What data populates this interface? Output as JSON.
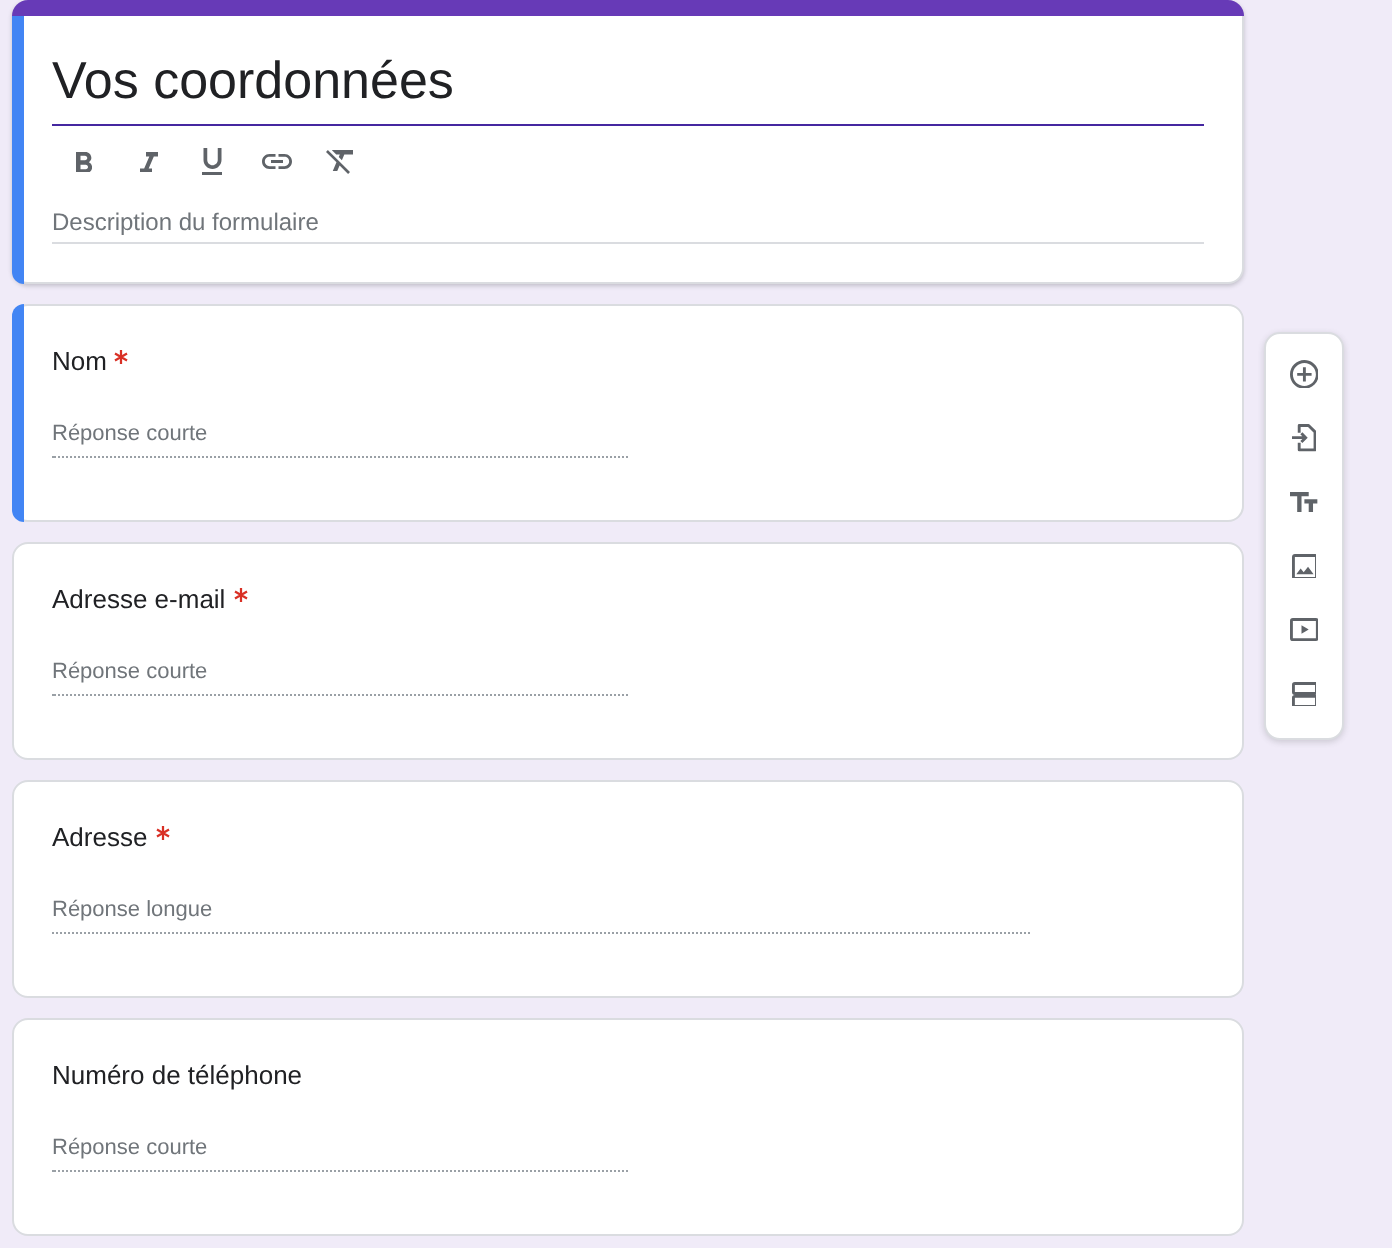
{
  "header": {
    "selected": true,
    "title": "Vos coordonnées",
    "format_tools": [
      {
        "kind": "bold"
      },
      {
        "kind": "italic"
      },
      {
        "kind": "underline"
      },
      {
        "kind": "link"
      },
      {
        "kind": "clear_formatting"
      }
    ],
    "description": {
      "placeholder": "Description du formulaire"
    }
  },
  "questions": [
    {
      "title": "Nom",
      "required": true,
      "selected": true,
      "answer": {
        "kind": "short",
        "placeholder": "Réponse courte"
      }
    },
    {
      "title": "Adresse e-mail",
      "required": true,
      "selected": false,
      "answer": {
        "kind": "short",
        "placeholder": "Réponse courte"
      }
    },
    {
      "title": "Adresse",
      "required": true,
      "selected": false,
      "answer": {
        "kind": "long",
        "placeholder": "Réponse longue"
      }
    },
    {
      "title": "Numéro de téléphone",
      "required": false,
      "selected": false,
      "answer": {
        "kind": "short",
        "placeholder": "Réponse courte"
      }
    }
  ],
  "side_toolbar": [
    {
      "kind": "add_question"
    },
    {
      "kind": "import_questions"
    },
    {
      "kind": "add_title"
    },
    {
      "kind": "add_image"
    },
    {
      "kind": "add_video"
    },
    {
      "kind": "add_section"
    }
  ]
}
